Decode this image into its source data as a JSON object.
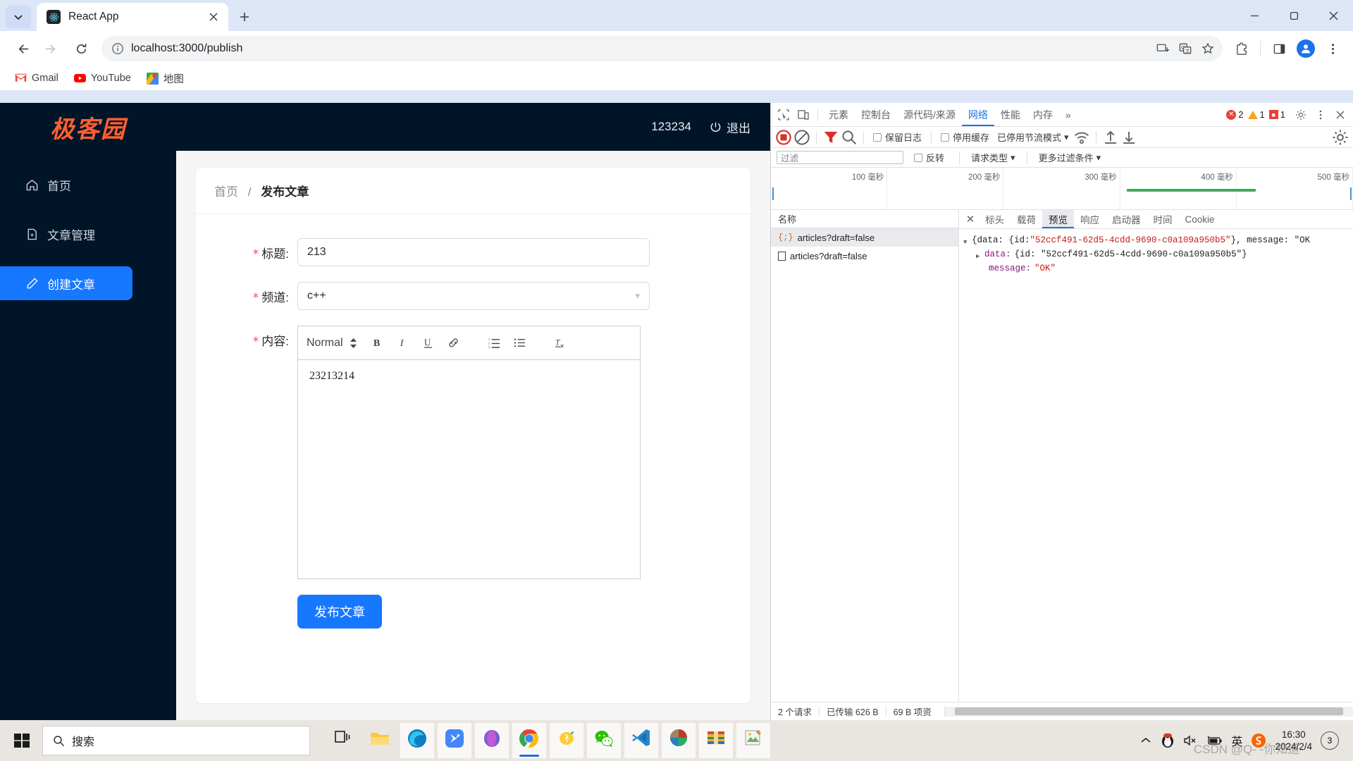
{
  "browser": {
    "tab": {
      "title": "React App",
      "favicon": "react-logo-icon"
    },
    "new_tab_label": "+",
    "window_controls": {
      "minimize": "minimize-icon",
      "maximize": "maximize-icon",
      "close": "close-icon"
    },
    "omnibox": {
      "url": "localhost:3000/publish",
      "site_info_icon": "info-circle-icon"
    },
    "nav": {
      "back": "back-arrow-icon",
      "forward": "forward-arrow-icon",
      "reload": "reload-icon"
    },
    "toolbar_right": [
      "install-icon",
      "translate-icon",
      "bookmark-star-icon",
      "extensions-icon",
      "side-panel-icon",
      "profile-avatar",
      "three-dot-menu-icon"
    ],
    "bookmarks": [
      {
        "label": "Gmail",
        "icon": "gmail-icon"
      },
      {
        "label": "YouTube",
        "icon": "youtube-icon"
      },
      {
        "label": "地图",
        "icon": "google-maps-icon"
      }
    ]
  },
  "app": {
    "brand": "极客园",
    "user_name": "123234",
    "logout_label": "退出",
    "sidebar": [
      {
        "label": "首页",
        "icon": "home-icon",
        "active": false
      },
      {
        "label": "文章管理",
        "icon": "document-icon",
        "active": false
      },
      {
        "label": "创建文章",
        "icon": "edit-pencil-icon",
        "active": true
      }
    ],
    "breadcrumb": {
      "home": "首页",
      "separator": "/",
      "current": "发布文章"
    },
    "form": {
      "title_label": "标题:",
      "title_value": "213",
      "channel_label": "频道:",
      "channel_value": "c++",
      "content_label": "内容:",
      "content_value": "23213214",
      "required_mark": "*",
      "submit_label": "发布文章"
    },
    "editor_toolbar": {
      "format_select": "Normal",
      "buttons": [
        "bold-icon",
        "italic-icon",
        "underline-icon",
        "link-icon",
        "ordered-list-icon",
        "bullet-list-icon",
        "clear-format-icon"
      ]
    },
    "colors": {
      "accent": "#1677ff",
      "brand": "#ff5f2e",
      "sidebar_bg": "#011529"
    }
  },
  "devtools": {
    "tabs": [
      {
        "label": "元素",
        "active": false
      },
      {
        "label": "控制台",
        "active": false
      },
      {
        "label": "源代码/来源",
        "active": false
      },
      {
        "label": "网络",
        "active": true
      },
      {
        "label": "性能",
        "active": false
      },
      {
        "label": "内存",
        "active": false
      },
      {
        "label": "»",
        "active": false
      }
    ],
    "counters": {
      "errors": "2",
      "warnings": "1",
      "issues": "1"
    },
    "right_icons": [
      "settings-gear-icon",
      "three-dot-menu-icon",
      "close-icon"
    ],
    "left_icons": [
      "inspect-element-icon",
      "device-toolbar-icon"
    ],
    "toolbar": {
      "record_icon": "record-stop-icon",
      "clear_icon": "clear-circle-icon",
      "filter_icon": "filter-funnel-icon",
      "search_icon": "search-icon",
      "preserve_log": "保留日志",
      "disable_cache": "停用缓存",
      "throttling": "已停用节流模式",
      "wifi_icon": "network-conditions-icon",
      "import_icon": "import-har-icon",
      "export_icon": "export-har-icon",
      "settings_icon": "settings-gear-icon"
    },
    "filterbar": {
      "filter_placeholder": "过滤",
      "invert_label": "反转",
      "request_type": "请求类型",
      "more_filters": "更多过滤条件"
    },
    "timeline": {
      "ticks": [
        "100 毫秒",
        "200 毫秒",
        "300 毫秒",
        "400 毫秒",
        "500 毫秒"
      ]
    },
    "request_list": {
      "column_header": "名称",
      "rows": [
        {
          "name": "articles?draft=false",
          "icon": "json-icon",
          "selected": true
        },
        {
          "name": "articles?draft=false",
          "icon": "document-icon",
          "selected": false
        }
      ]
    },
    "detail_tabs": [
      {
        "label": "标头",
        "active": false
      },
      {
        "label": "载荷",
        "active": false
      },
      {
        "label": "预览",
        "active": true
      },
      {
        "label": "响应",
        "active": false
      },
      {
        "label": "启动器",
        "active": false
      },
      {
        "label": "时间",
        "active": false
      },
      {
        "label": "Cookie",
        "active": false
      }
    ],
    "preview": {
      "line1_prefix": "{data: {id: ",
      "line1_id": "\"52ccf491-62d5-4cdd-9690-c0a109a950b5\"",
      "line1_suffix": "}, message: \"OK",
      "line2_key": "data:",
      "line2_val": "{id: \"52ccf491-62d5-4cdd-9690-c0a109a950b5\"}",
      "line3_key": "message:",
      "line3_val": "\"OK\""
    },
    "status": {
      "requests": "2 个请求",
      "transferred": "已传输 626 B",
      "resources": "69 B 项资"
    }
  },
  "taskbar": {
    "start_icon": "windows-logo-icon",
    "search_placeholder": "搜索",
    "task_view_icon": "task-view-icon",
    "apps": [
      {
        "name": "file-explorer-icon",
        "active": false
      },
      {
        "name": "microsoft-edge-icon",
        "active": true
      },
      {
        "name": "bird-app-icon",
        "active": true
      },
      {
        "name": "microsoft-365-icon",
        "active": true
      },
      {
        "name": "google-chrome-icon",
        "active": true
      },
      {
        "name": "lemon-app-icon",
        "active": true
      },
      {
        "name": "wechat-icon",
        "active": true
      },
      {
        "name": "vs-code-icon",
        "active": true
      },
      {
        "name": "photos-icon",
        "active": true
      },
      {
        "name": "winrar-icon",
        "active": true
      },
      {
        "name": "image-editor-icon",
        "active": true
      }
    ],
    "tray": [
      "chevron-up-icon",
      "qq-penguin-icon",
      "volume-muted-icon",
      "battery-icon",
      "ime-chinese-icon",
      "sogou-input-icon"
    ],
    "ime_label": "英",
    "sogou_label": "S",
    "clock": {
      "time": "16:30",
      "date": "2024/2/4"
    },
    "notification_count": "3",
    "watermark": "CSDN @Q- -你知道-"
  }
}
